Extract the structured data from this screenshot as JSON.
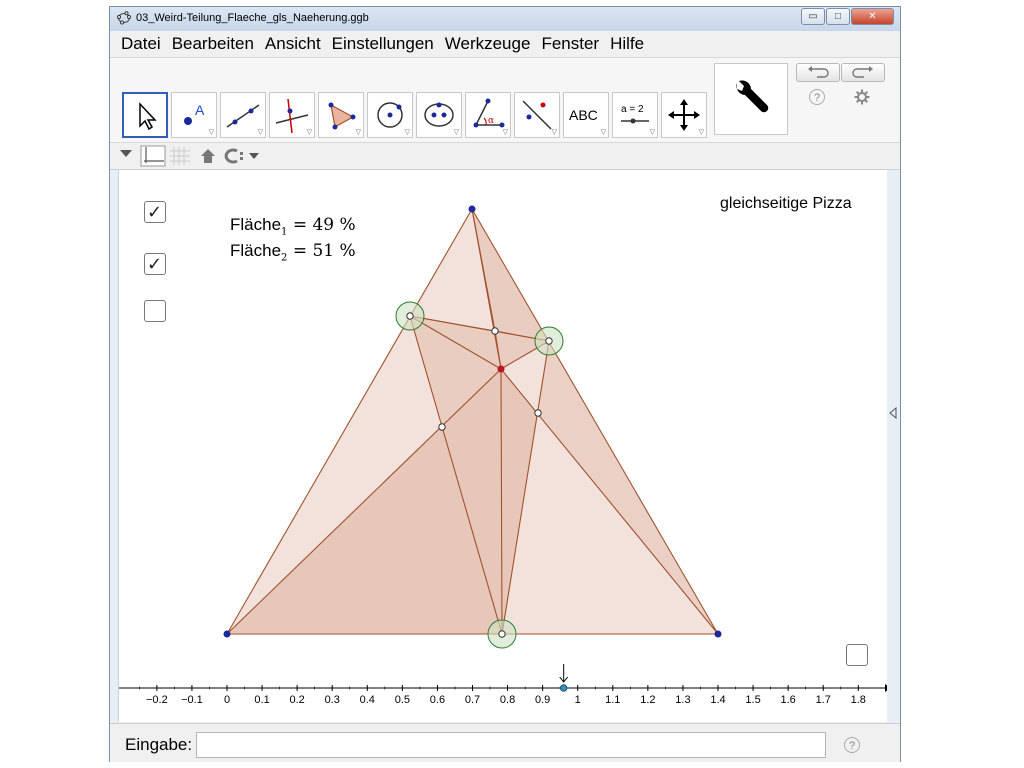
{
  "window": {
    "title": "03_Weird-Teilung_Flaeche_gls_Naeherung.ggb",
    "controls": {
      "minimize": "▭",
      "maximize": "□",
      "close": "✕"
    }
  },
  "menu": [
    "Datei",
    "Bearbeiten",
    "Ansicht",
    "Einstellungen",
    "Werkzeuge",
    "Fenster",
    "Hilfe"
  ],
  "toolbar": {
    "tools": [
      {
        "name": "move-tool",
        "icon": "arrow-cursor-icon",
        "selected": true
      },
      {
        "name": "point-tool",
        "icon": "point-icon",
        "text": "A"
      },
      {
        "name": "line-tool",
        "icon": "line-icon"
      },
      {
        "name": "perpendicular-line-tool",
        "icon": "perpendicular-icon"
      },
      {
        "name": "polygon-tool",
        "icon": "polygon-icon"
      },
      {
        "name": "circle-tool",
        "icon": "circle-icon"
      },
      {
        "name": "conic-tool",
        "icon": "ellipse-icon"
      },
      {
        "name": "angle-tool",
        "icon": "angle-icon",
        "text": "α"
      },
      {
        "name": "reflect-tool",
        "icon": "reflect-icon"
      },
      {
        "name": "text-tool",
        "icon": "text-icon",
        "text": "ABC"
      },
      {
        "name": "slider-tool",
        "icon": "slider-icon",
        "text": "a = 2"
      },
      {
        "name": "move-graphics-tool",
        "icon": "move-graphics-icon"
      }
    ],
    "settings_icon": "wrench-icon",
    "undo_icon": "undo-icon",
    "redo_icon": "redo-icon",
    "help_icon": "help-icon",
    "gear_icon": "gear-icon"
  },
  "stylebar": {
    "icons": [
      "dropdown-icon",
      "axes-icon",
      "grid-icon",
      "home-icon",
      "point-capture-icon"
    ]
  },
  "graphics": {
    "checkboxes": [
      {
        "name": "checkbox-1",
        "checked": true
      },
      {
        "name": "checkbox-2",
        "checked": true
      },
      {
        "name": "checkbox-3",
        "checked": false
      },
      {
        "name": "checkbox-4",
        "checked": false
      }
    ],
    "area1": {
      "label": "Fläche",
      "sub": "1",
      "value": "= 49 %"
    },
    "area2": {
      "label": "Fläche",
      "sub": "2",
      "value": "= 51 %"
    },
    "caption": "gleichseitige Pizza",
    "axis_ticks": [
      "−0.2",
      "−0.1",
      "0",
      "0.1",
      "0.2",
      "0.3",
      "0.4",
      "0.5",
      "0.6",
      "0.7",
      "0.8",
      "0.9",
      "1",
      "1.1",
      "1.2",
      "1.3",
      "1.4",
      "1.5",
      "1.6",
      "1.7",
      "1.8"
    ],
    "slider_value": 0.96,
    "colors": {
      "fill": "#e8c6b8",
      "fill_dark": "#d9a792",
      "edge": "#a0522d",
      "vertex": "#1a2a9a",
      "center": "#c0161d",
      "angle": "#2e7d32"
    }
  },
  "inputbar": {
    "label": "Eingabe:",
    "value": "",
    "help": "?"
  }
}
